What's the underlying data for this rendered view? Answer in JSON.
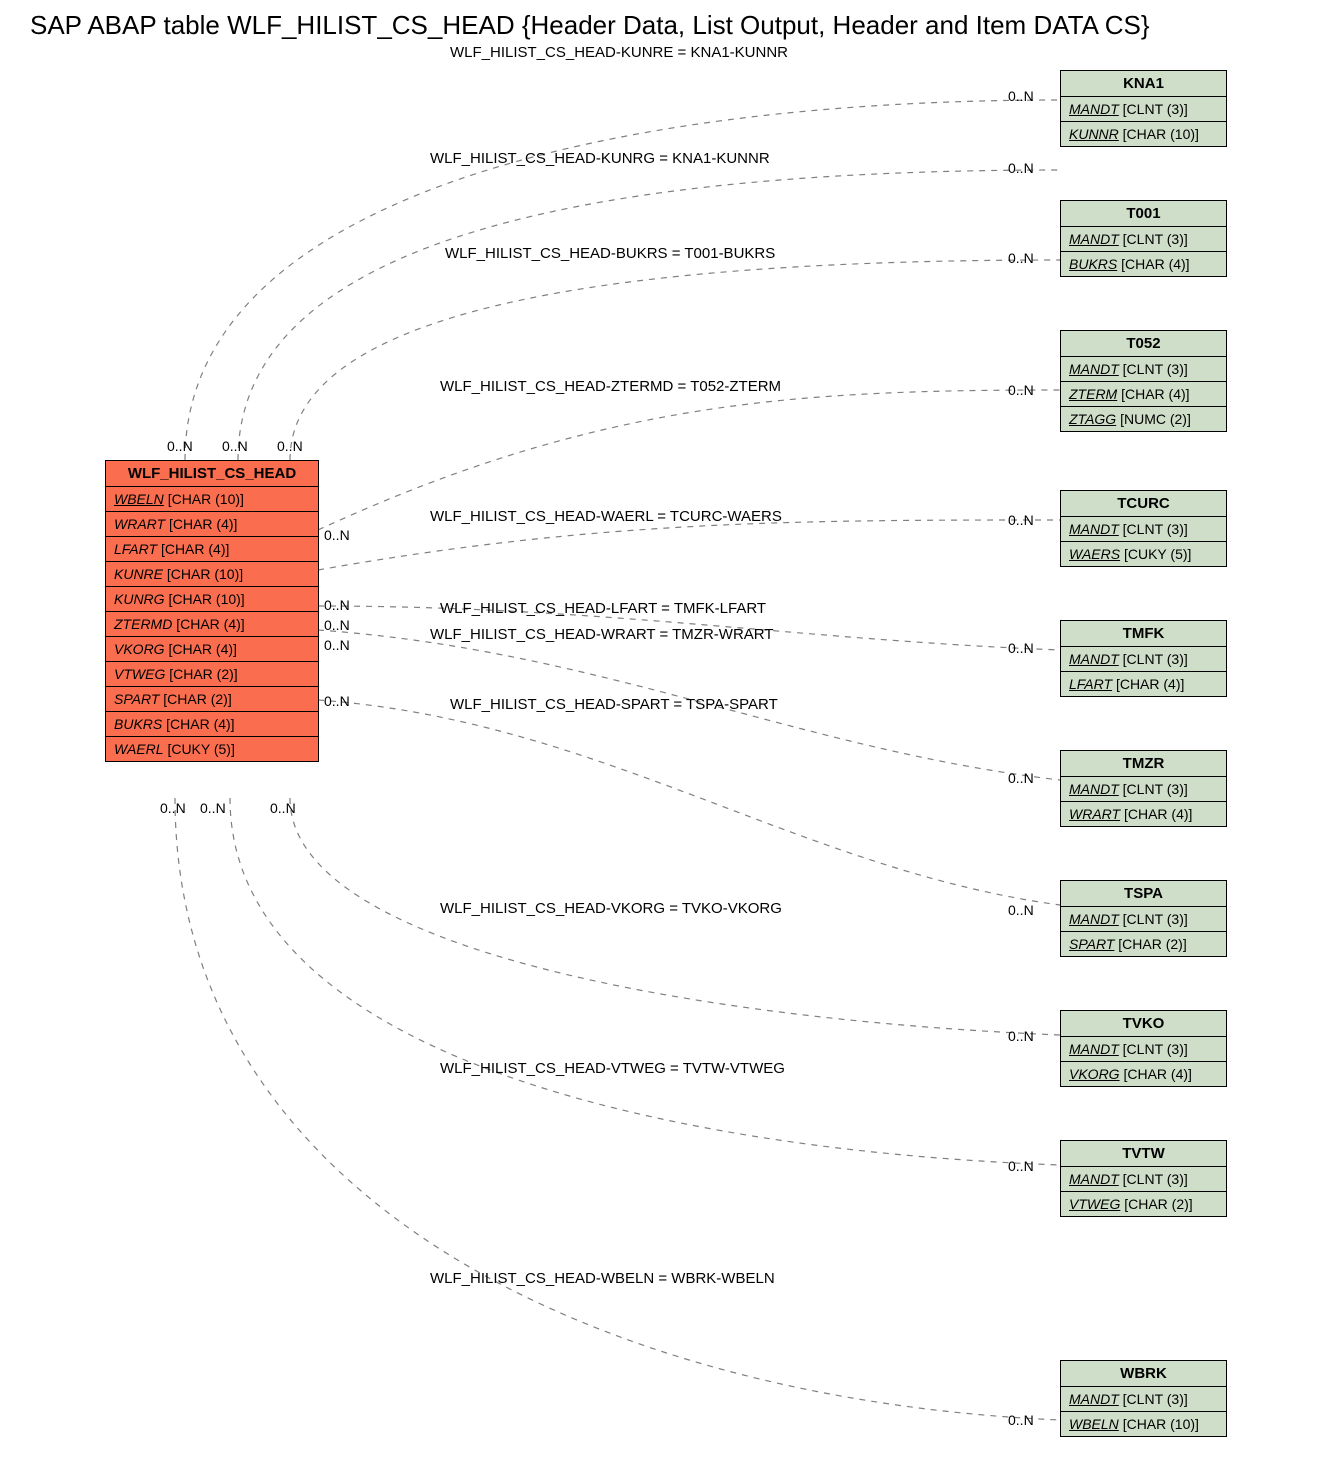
{
  "title": "SAP ABAP table WLF_HILIST_CS_HEAD {Header Data, List Output, Header and Item DATA CS}",
  "main": {
    "name": "WLF_HILIST_CS_HEAD",
    "fields": [
      {
        "name": "WBELN",
        "type": "[CHAR (10)]",
        "ul": true
      },
      {
        "name": "WRART",
        "type": "[CHAR (4)]",
        "ul": false
      },
      {
        "name": "LFART",
        "type": "[CHAR (4)]",
        "ul": false
      },
      {
        "name": "KUNRE",
        "type": "[CHAR (10)]",
        "ul": false
      },
      {
        "name": "KUNRG",
        "type": "[CHAR (10)]",
        "ul": false
      },
      {
        "name": "ZTERMD",
        "type": "[CHAR (4)]",
        "ul": false
      },
      {
        "name": "VKORG",
        "type": "[CHAR (4)]",
        "ul": false
      },
      {
        "name": "VTWEG",
        "type": "[CHAR (2)]",
        "ul": false
      },
      {
        "name": "SPART",
        "type": "[CHAR (2)]",
        "ul": false
      },
      {
        "name": "BUKRS",
        "type": "[CHAR (4)]",
        "ul": false
      },
      {
        "name": "WAERL",
        "type": "[CUKY (5)]",
        "ul": false
      }
    ]
  },
  "refs": [
    {
      "name": "KNA1",
      "fields": [
        {
          "name": "MANDT",
          "type": "[CLNT (3)]",
          "ul": true
        },
        {
          "name": "KUNNR",
          "type": "[CHAR (10)]",
          "ul": true
        }
      ]
    },
    {
      "name": "T001",
      "fields": [
        {
          "name": "MANDT",
          "type": "[CLNT (3)]",
          "ul": true
        },
        {
          "name": "BUKRS",
          "type": "[CHAR (4)]",
          "ul": true
        }
      ]
    },
    {
      "name": "T052",
      "fields": [
        {
          "name": "MANDT",
          "type": "[CLNT (3)]",
          "ul": true
        },
        {
          "name": "ZTERM",
          "type": "[CHAR (4)]",
          "ul": true
        },
        {
          "name": "ZTAGG",
          "type": "[NUMC (2)]",
          "ul": true
        }
      ]
    },
    {
      "name": "TCURC",
      "fields": [
        {
          "name": "MANDT",
          "type": "[CLNT (3)]",
          "ul": true
        },
        {
          "name": "WAERS",
          "type": "[CUKY (5)]",
          "ul": true
        }
      ]
    },
    {
      "name": "TMFK",
      "fields": [
        {
          "name": "MANDT",
          "type": "[CLNT (3)]",
          "ul": true
        },
        {
          "name": "LFART",
          "type": "[CHAR (4)]",
          "ul": true
        }
      ]
    },
    {
      "name": "TMZR",
      "fields": [
        {
          "name": "MANDT",
          "type": "[CLNT (3)]",
          "ul": true
        },
        {
          "name": "WRART",
          "type": "[CHAR (4)]",
          "ul": true
        }
      ]
    },
    {
      "name": "TSPA",
      "fields": [
        {
          "name": "MANDT",
          "type": "[CLNT (3)]",
          "ul": true
        },
        {
          "name": "SPART",
          "type": "[CHAR (2)]",
          "ul": true
        }
      ]
    },
    {
      "name": "TVKO",
      "fields": [
        {
          "name": "MANDT",
          "type": "[CLNT (3)]",
          "ul": true
        },
        {
          "name": "VKORG",
          "type": "[CHAR (4)]",
          "ul": true
        }
      ]
    },
    {
      "name": "TVTW",
      "fields": [
        {
          "name": "MANDT",
          "type": "[CLNT (3)]",
          "ul": true
        },
        {
          "name": "VTWEG",
          "type": "[CHAR (2)]",
          "ul": true
        }
      ]
    },
    {
      "name": "WBRK",
      "fields": [
        {
          "name": "MANDT",
          "type": "[CLNT (3)]",
          "ul": true
        },
        {
          "name": "WBELN",
          "type": "[CHAR (10)]",
          "ul": true
        }
      ]
    }
  ],
  "edges": [
    {
      "label": "WLF_HILIST_CS_HEAD-KUNRE = KNA1-KUNNR"
    },
    {
      "label": "WLF_HILIST_CS_HEAD-KUNRG = KNA1-KUNNR"
    },
    {
      "label": "WLF_HILIST_CS_HEAD-BUKRS = T001-BUKRS"
    },
    {
      "label": "WLF_HILIST_CS_HEAD-ZTERMD = T052-ZTERM"
    },
    {
      "label": "WLF_HILIST_CS_HEAD-WAERL = TCURC-WAERS"
    },
    {
      "label": "WLF_HILIST_CS_HEAD-LFART = TMFK-LFART"
    },
    {
      "label": "WLF_HILIST_CS_HEAD-WRART = TMZR-WRART"
    },
    {
      "label": "WLF_HILIST_CS_HEAD-SPART = TSPA-SPART"
    },
    {
      "label": "WLF_HILIST_CS_HEAD-VKORG = TVKO-VKORG"
    },
    {
      "label": "WLF_HILIST_CS_HEAD-VTWEG = TVTW-VTWEG"
    },
    {
      "label": "WLF_HILIST_CS_HEAD-WBELN = WBRK-WBELN"
    }
  ],
  "card": "0..N"
}
